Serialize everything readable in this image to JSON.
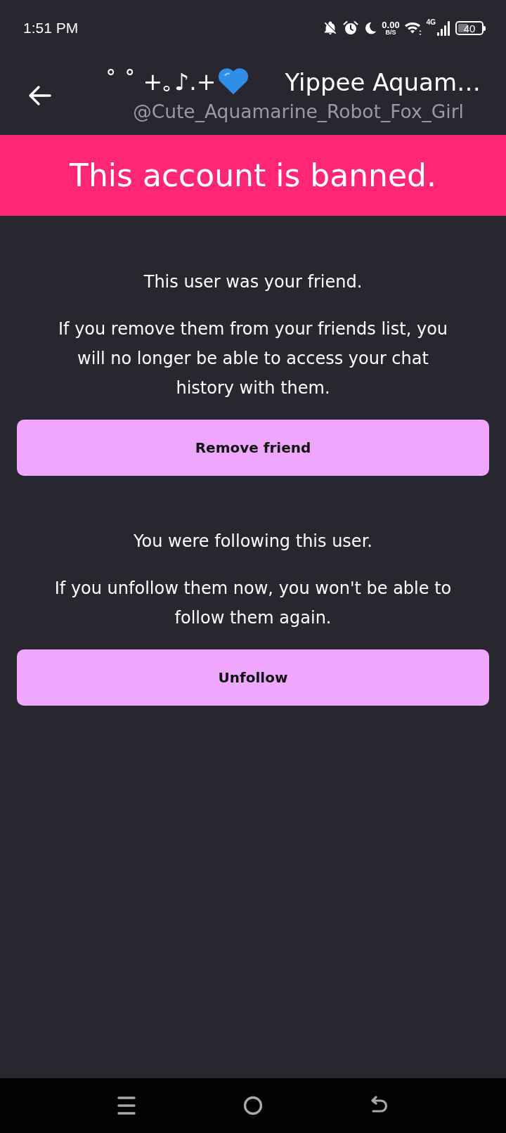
{
  "status_bar": {
    "time": "1:51 PM",
    "net_speed": "0.00",
    "net_unit": "B/S",
    "network_type": "4G",
    "battery": "40"
  },
  "header": {
    "name_prefix": "˚ ˚ +｡♪.+",
    "name": "Yippee Aquam…",
    "handle": "@Cute_Aquamarine_Robot_Fox_Girl"
  },
  "banner": {
    "text": "This account is banned."
  },
  "sections": [
    {
      "heading": "This user was your friend.",
      "body": "If you remove them from your friends list, you will no longer be able to access your chat history with them.",
      "button": "Remove friend"
    },
    {
      "heading": "You were following this user.",
      "body": "If you unfollow them now, you won't be able to follow them again.",
      "button": "Unfollow"
    }
  ]
}
